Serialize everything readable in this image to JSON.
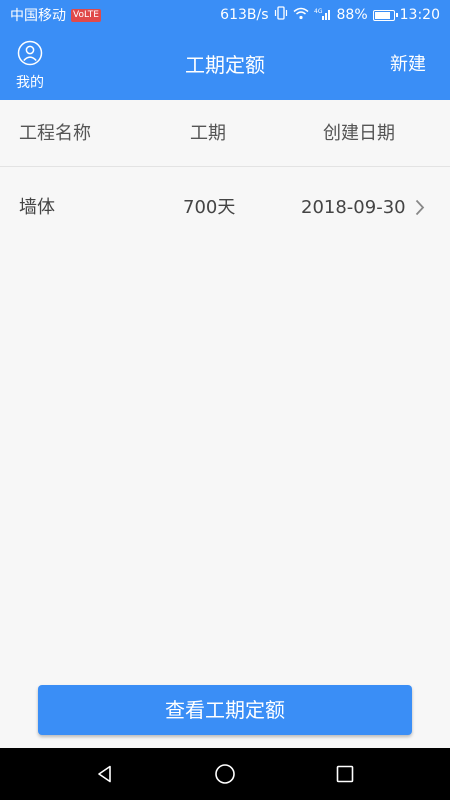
{
  "status_bar": {
    "carrier": "中国移动",
    "volte": "VoLTE",
    "net_speed": "613B/s",
    "signal": "4G",
    "battery_percent": "88%",
    "battery_level": 0.88,
    "time": "13:20"
  },
  "app_bar": {
    "mine_label": "我的",
    "title": "工期定额",
    "new_label": "新建",
    "color": "#3a8ef6"
  },
  "table": {
    "headers": [
      "工程名称",
      "工期",
      "创建日期"
    ],
    "rows": [
      {
        "name": "墙体",
        "duration": "700天",
        "date": "2018-09-30"
      }
    ]
  },
  "action_button": {
    "label": "查看工期定额"
  },
  "icons": {
    "mine": "user-circle-icon",
    "row_chevron": "chevron-right-icon",
    "nav": [
      "back-triangle-icon",
      "home-circle-icon",
      "recents-square-icon"
    ]
  }
}
